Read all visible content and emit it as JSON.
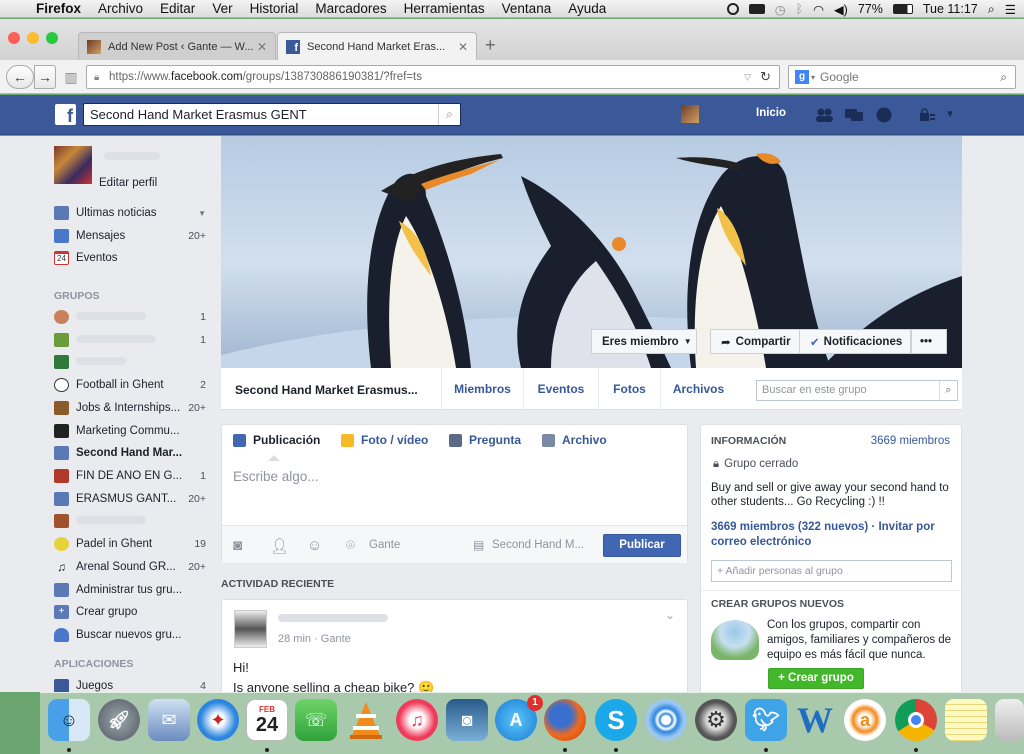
{
  "menubar": {
    "app": "Firefox",
    "items": [
      "Archivo",
      "Editar",
      "Ver",
      "Historial",
      "Marcadores",
      "Herramientas",
      "Ventana",
      "Ayuda"
    ],
    "battery": "77%",
    "clock": "Tue 11:17"
  },
  "browser": {
    "tabs": [
      {
        "title": "Add New Post ‹ Gante — W..."
      },
      {
        "title": "Second Hand Market Eras..."
      }
    ],
    "url_prefix": "https://www.",
    "url_domain": "facebook.com",
    "url_path": "/groups/138730886190381/?fref=ts",
    "search_placeholder": "Google"
  },
  "fb": {
    "search_value": "Second Hand Market Erasmus GENT",
    "home": "Inicio"
  },
  "sidebar": {
    "edit_profile": "Editar perfil",
    "favorites": [
      {
        "label": "Últimas noticias",
        "count": ""
      },
      {
        "label": "Mensajes",
        "count": "20+"
      },
      {
        "label": "Eventos",
        "count": ""
      }
    ],
    "groups_header": "GRUPOS",
    "groups": [
      {
        "label": "",
        "count": "1"
      },
      {
        "label": "",
        "count": "1"
      },
      {
        "label": "",
        "count": ""
      },
      {
        "label": "Football in Ghent",
        "count": "2"
      },
      {
        "label": "Jobs & Internships...",
        "count": "20+"
      },
      {
        "label": "Marketing Commu...",
        "count": ""
      },
      {
        "label": "Second Hand Mar...",
        "count": ""
      },
      {
        "label": "FIN DE AÑO EN G...",
        "count": "1"
      },
      {
        "label": "ERASMUS GANT...",
        "count": "20+"
      },
      {
        "label": "",
        "count": ""
      },
      {
        "label": "Padel in Ghent",
        "count": "19"
      },
      {
        "label": "Arenal Sound GR...",
        "count": "20+"
      },
      {
        "label": "Administrar tus gru...",
        "count": ""
      },
      {
        "label": "Crear grupo",
        "count": ""
      },
      {
        "label": "Buscar nuevos gru...",
        "count": ""
      }
    ],
    "apps_header": "APLICACIONES",
    "apps": [
      {
        "label": "Juegos",
        "count": "4"
      }
    ]
  },
  "cover": {
    "member_btn": "Eres miembro",
    "share_btn": "Compartir",
    "notif_btn": "Notificaciones",
    "more_btn": "•••"
  },
  "groupnav": {
    "title": "Second Hand Market Erasmus...",
    "tabs": [
      "Miembros",
      "Eventos",
      "Fotos",
      "Archivos"
    ],
    "search_placeholder": "Buscar en este grupo"
  },
  "composer": {
    "tabs": [
      "Publicación",
      "Foto / vídeo",
      "Pregunta",
      "Archivo"
    ],
    "placeholder": "Escribe algo...",
    "location": "Gante",
    "audience": "Second Hand M...",
    "publish": "Publicar"
  },
  "activity_header": "ACTIVIDAD RECIENTE",
  "post": {
    "meta": "28 min · Gante",
    "line1": "Hi!",
    "line2": "Is anyone selling a cheap bike? 🙂"
  },
  "info": {
    "header": "INFORMACIÓN",
    "members": "3669 miembros",
    "privacy": "Grupo cerrado",
    "description": "Buy and sell or give away your second hand to other students... Go Recycling :) !!",
    "member_count": "3669 miembros (322 nuevos) · Invitar por correo electrónico",
    "add_people": "+ Añadir personas al grupo",
    "create_header": "CREAR GRUPOS NUEVOS",
    "create_text": "Con los grupos, compartir con amigos, familiares y compañeros de equipo es más fácil que nunca.",
    "create_btn": "+ Crear grupo"
  },
  "dock": {
    "calendar_month": "FEB",
    "calendar_day": "24",
    "appstore_badge": "1"
  }
}
